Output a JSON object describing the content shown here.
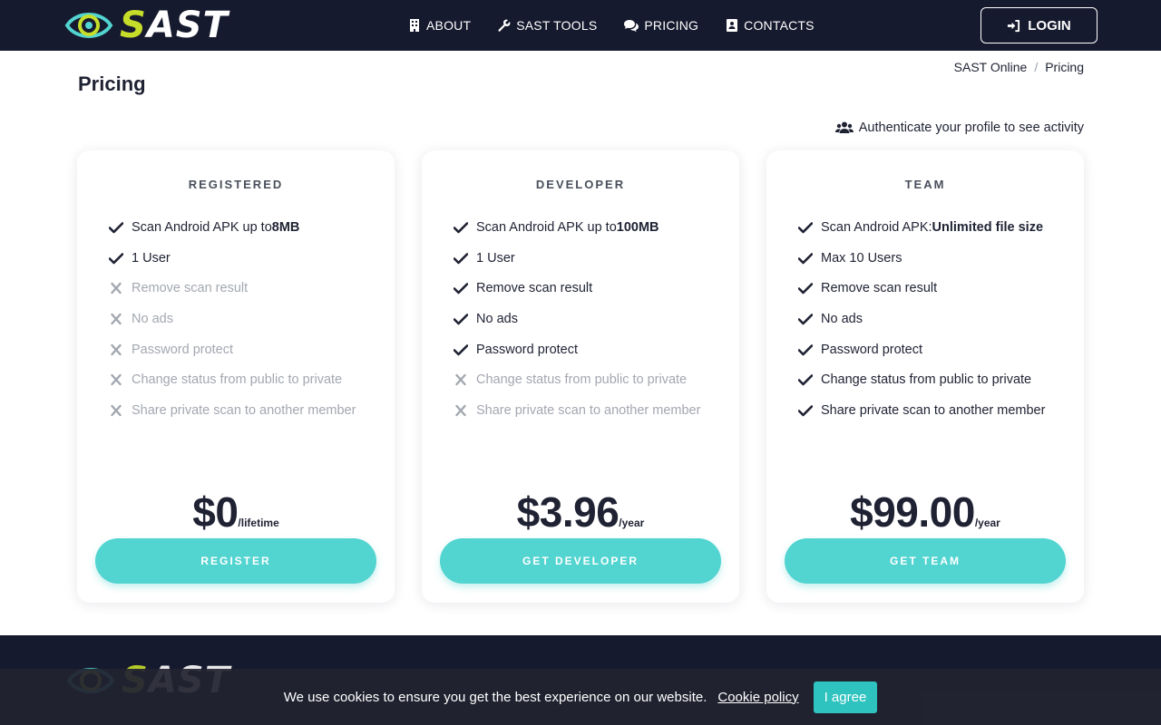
{
  "brand": {
    "name_first_letter": "S",
    "name_rest": "AST",
    "accent_color": "#c6dd2a",
    "eye_color": "#52d4d0"
  },
  "nav": {
    "items": [
      {
        "label": "ABOUT",
        "icon": "building-icon"
      },
      {
        "label": "SAST TOOLS",
        "icon": "wrench-icon"
      },
      {
        "label": "PRICING",
        "icon": "comments-icon"
      },
      {
        "label": "CONTACTS",
        "icon": "contact-card-icon"
      }
    ],
    "login_label": "LOGIN"
  },
  "page": {
    "title": "Pricing",
    "breadcrumb": {
      "home": "SAST Online",
      "sep": "/",
      "current": "Pricing"
    },
    "auth_note": "Authenticate your profile to see activity"
  },
  "plans": [
    {
      "name": "REGISTERED",
      "price": "$0",
      "period": "/lifetime",
      "cta": "REGISTER",
      "features": [
        {
          "text": "Scan Android APK up to ",
          "bold": "8MB",
          "included": true
        },
        {
          "text": "1 User",
          "bold": "",
          "included": true
        },
        {
          "text": "Remove scan result",
          "bold": "",
          "included": false
        },
        {
          "text": "No ads",
          "bold": "",
          "included": false
        },
        {
          "text": "Password protect",
          "bold": "",
          "included": false
        },
        {
          "text": "Change status from public to private",
          "bold": "",
          "included": false
        },
        {
          "text": "Share private scan to another member",
          "bold": "",
          "included": false
        }
      ]
    },
    {
      "name": "DEVELOPER",
      "price": "$3.96",
      "period": "/year",
      "cta": "GET DEVELOPER",
      "features": [
        {
          "text": "Scan Android APK up to ",
          "bold": "100MB",
          "included": true
        },
        {
          "text": "1 User",
          "bold": "",
          "included": true
        },
        {
          "text": "Remove scan result",
          "bold": "",
          "included": true
        },
        {
          "text": "No ads",
          "bold": "",
          "included": true
        },
        {
          "text": "Password protect",
          "bold": "",
          "included": true
        },
        {
          "text": "Change status from public to private",
          "bold": "",
          "included": false
        },
        {
          "text": "Share private scan to another member",
          "bold": "",
          "included": false
        }
      ]
    },
    {
      "name": "TEAM",
      "price": "$99.00",
      "period": "/year",
      "cta": "GET TEAM",
      "features": [
        {
          "text": "Scan Android APK: ",
          "bold": "Unlimited file size",
          "included": true
        },
        {
          "text": "Max 10 Users",
          "bold": "",
          "included": true
        },
        {
          "text": "Remove scan result",
          "bold": "",
          "included": true
        },
        {
          "text": "No ads",
          "bold": "",
          "included": true
        },
        {
          "text": "Password protect",
          "bold": "",
          "included": true
        },
        {
          "text": "Change status from public to private",
          "bold": "",
          "included": true
        },
        {
          "text": "Share private scan to another member",
          "bold": "",
          "included": true
        }
      ]
    }
  ],
  "cookie": {
    "text": "We use cookies to ensure you get the best experience on our website.",
    "link": "Cookie policy",
    "button": "I agree"
  },
  "colors": {
    "header_bg": "#161a2e",
    "cta": "#52d4d0",
    "check": "#1f2233",
    "cross": "#a3a7b0"
  }
}
